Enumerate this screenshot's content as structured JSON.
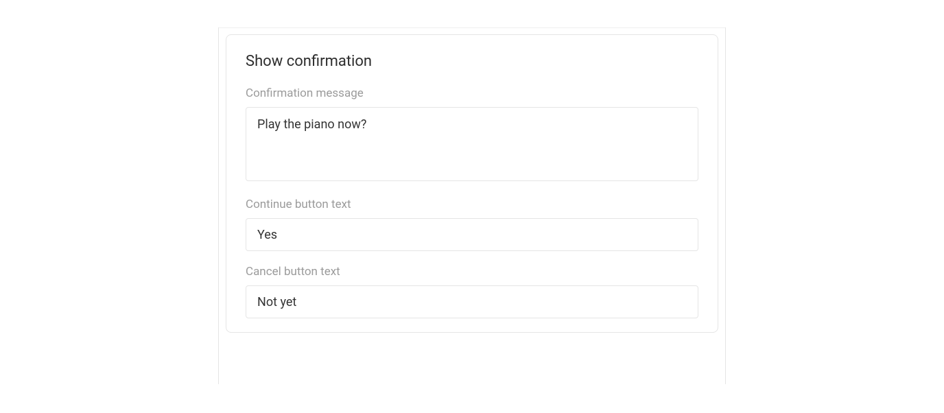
{
  "panel": {
    "title": "Show confirmation",
    "fields": {
      "confirmation_message": {
        "label": "Confirmation message",
        "value": "Play the piano now?"
      },
      "continue_button_text": {
        "label": "Continue button text",
        "value": "Yes"
      },
      "cancel_button_text": {
        "label": "Cancel button text",
        "value": "Not yet"
      }
    }
  }
}
